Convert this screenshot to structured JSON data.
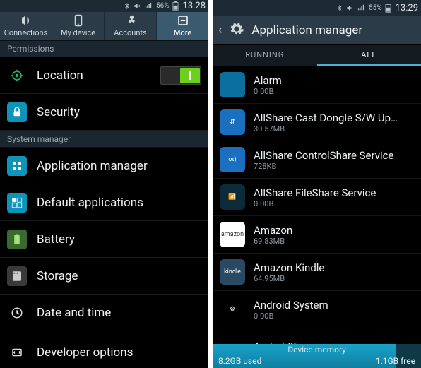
{
  "left": {
    "status": {
      "battery_pct": "56%",
      "time": "13:28"
    },
    "tabs": [
      {
        "label": "Connections"
      },
      {
        "label": "My device"
      },
      {
        "label": "Accounts"
      },
      {
        "label": "More"
      }
    ],
    "section_permissions": "Permissions",
    "row_location": "Location",
    "row_security": "Security",
    "section_system": "System manager",
    "row_appmgr": "Application manager",
    "row_defaultapps": "Default applications",
    "row_battery": "Battery",
    "row_storage": "Storage",
    "row_datetime": "Date and time",
    "row_devoptions": "Developer options"
  },
  "right": {
    "status": {
      "battery_pct": "55%",
      "time": "13:29"
    },
    "header_title": "Application manager",
    "subtabs": {
      "running": "RUNNING",
      "all": "ALL"
    },
    "apps": [
      {
        "name": "Alarm",
        "size": "0.00B",
        "icon_bg": "#0b6fa0",
        "icon_txt": ""
      },
      {
        "name": "AllShare Cast Dongle S/W Upd..",
        "size": "30.57MB",
        "icon_bg": "#1a6fbf",
        "icon_txt": "⇵"
      },
      {
        "name": "AllShare ControlShare Service",
        "size": "728KB",
        "icon_bg": "#1a6fbf",
        "icon_txt": "οι)"
      },
      {
        "name": "AllShare FileShare Service",
        "size": "0.00B",
        "icon_bg": "#0b2a3a",
        "icon_txt": "📶"
      },
      {
        "name": "Amazon",
        "size": "69.83MB",
        "icon_bg": "#ffffff",
        "icon_txt": "amazon"
      },
      {
        "name": "Amazon Kindle",
        "size": "64.95MB",
        "icon_bg": "#2a4a63",
        "icon_txt": "kindle"
      },
      {
        "name": "Android System",
        "size": "0.00B",
        "icon_bg": "",
        "icon_txt": "⚙"
      },
      {
        "name": "Androidify",
        "size": "",
        "icon_bg": "",
        "icon_txt": ""
      }
    ],
    "storage": {
      "label": "Device memory",
      "used": "8.2GB used",
      "free": "1.1GB free"
    }
  }
}
